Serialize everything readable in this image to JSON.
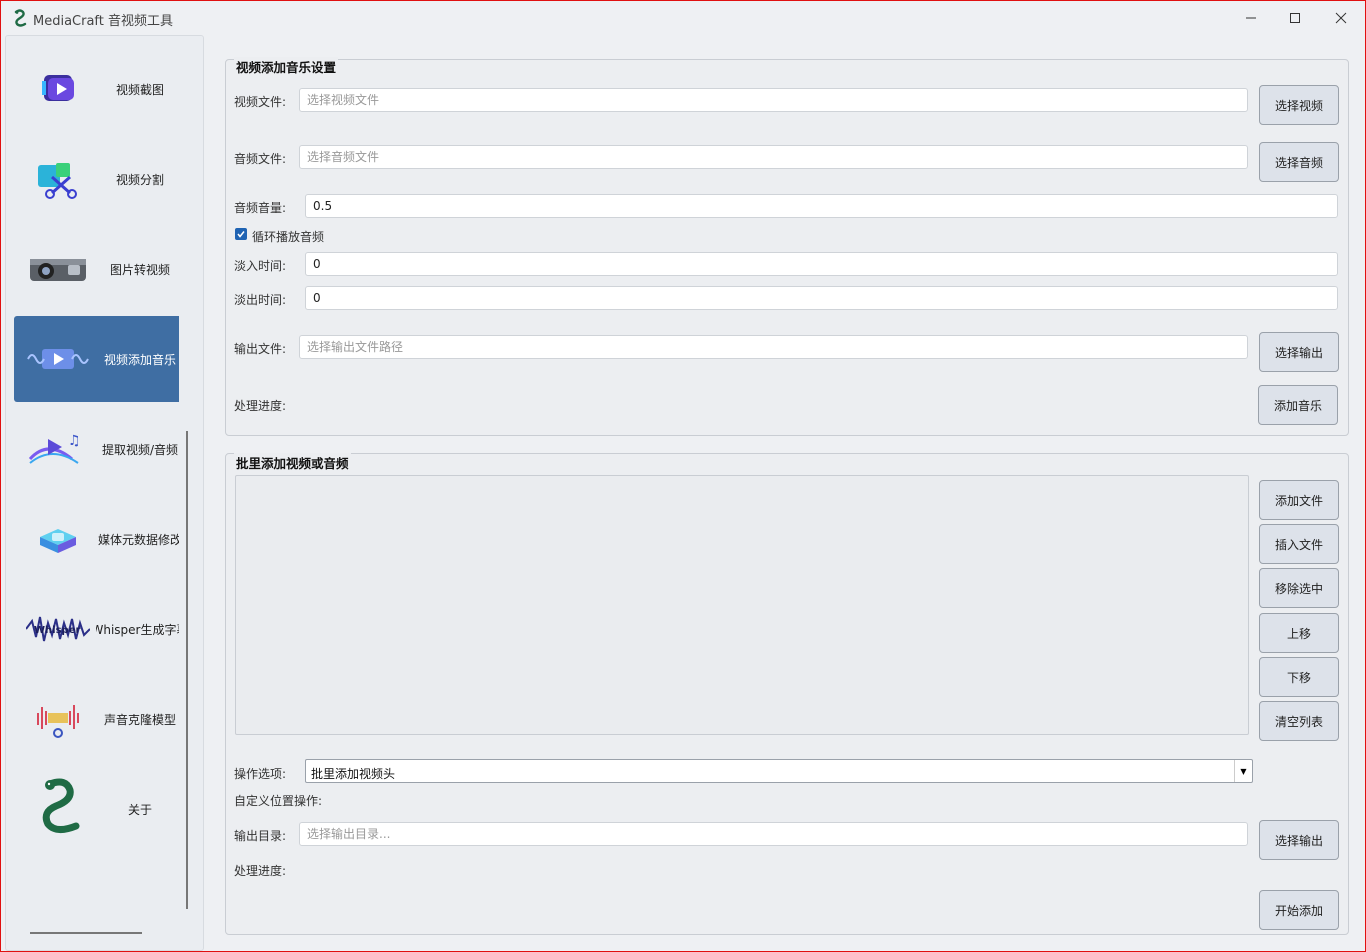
{
  "window": {
    "title": "MediaCraft 音视频工具",
    "controls": [
      "minimize-icon",
      "maximize-icon",
      "close-icon"
    ]
  },
  "sidebar": {
    "items": [
      {
        "label": "视频截图",
        "icon": "video-snapshot-icon",
        "active": false
      },
      {
        "label": "视频分割",
        "icon": "video-scissors-icon",
        "active": false
      },
      {
        "label": "图片转视频",
        "icon": "camera-icon",
        "active": false
      },
      {
        "label": "视频添加音乐",
        "icon": "video-music-icon",
        "active": true
      },
      {
        "label": "提取视频/音频",
        "icon": "extract-media-icon",
        "active": false
      },
      {
        "label": "媒体元数据修改",
        "icon": "metadata-icon",
        "active": false
      },
      {
        "label": "Whisper生成字幕",
        "icon": "whisper-icon",
        "active": false
      },
      {
        "label": "声音克隆模型",
        "icon": "voice-clone-icon",
        "active": false
      },
      {
        "label": "关于",
        "icon": "snake-logo-icon",
        "active": false
      }
    ]
  },
  "add_music": {
    "title": "视频添加音乐设置",
    "video_label": "视频文件:",
    "video_placeholder": "选择视频文件",
    "video_button": "选择视频",
    "audio_label": "音频文件:",
    "audio_placeholder": "选择音频文件",
    "audio_button": "选择音频",
    "volume_label": "音频音量:",
    "volume_value": "0.5",
    "loop_label": "循环播放音频",
    "loop_checked": true,
    "fade_in_label": "淡入时间:",
    "fade_in_value": "0",
    "fade_out_label": "淡出时间:",
    "fade_out_value": "0",
    "output_label": "输出文件:",
    "output_placeholder": "选择输出文件路径",
    "output_button": "选择输出",
    "progress_label": "处理进度:",
    "action_button": "添加音乐"
  },
  "batch": {
    "title": "批里添加视频或音频",
    "buttons": {
      "add": "添加文件",
      "insert": "插入文件",
      "remove": "移除选中",
      "up": "上移",
      "down": "下移",
      "clear": "清空列表"
    },
    "option_label": "操作选项:",
    "option_value": "批里添加视频头",
    "custom_label": "自定义位置操作:",
    "output_dir_label": "输出目录:",
    "output_dir_placeholder": "选择输出目录...",
    "output_dir_button": "选择输出",
    "progress_label": "处理进度:",
    "start_button": "开始添加"
  },
  "colors": {
    "accent": "#3f6ea3",
    "checkbox": "#1f63b3",
    "window_border": "#e01010"
  }
}
